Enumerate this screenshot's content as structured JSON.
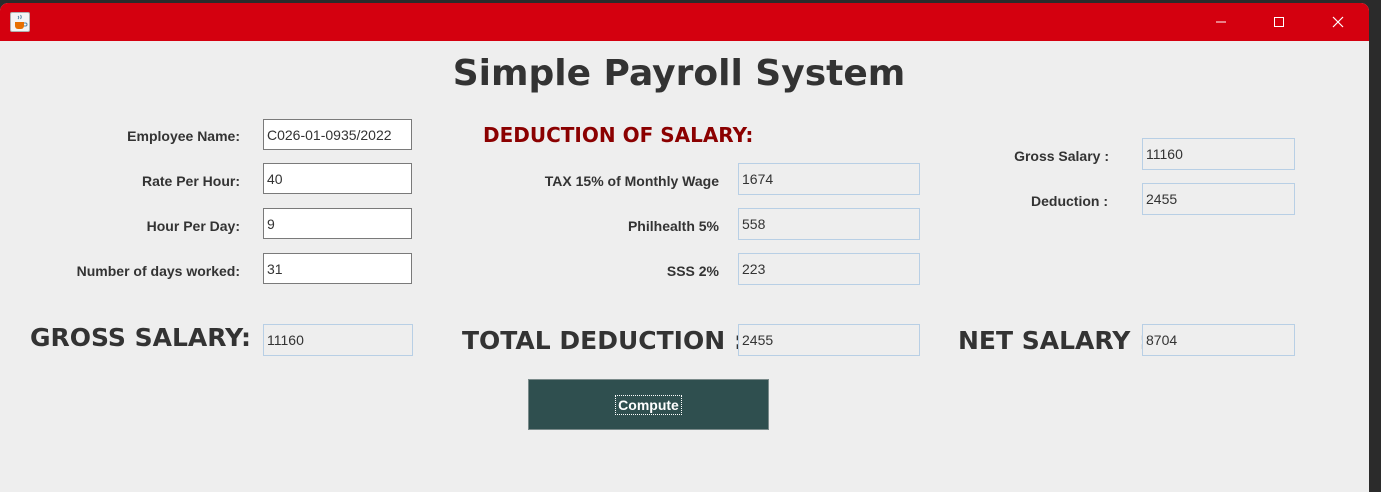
{
  "window": {
    "icon": "java-cup-icon",
    "controls": [
      "minimize-icon",
      "maximize-icon",
      "close-icon"
    ]
  },
  "title": "Simple Payroll System",
  "inputs": {
    "employee_name_label": "Employee Name:",
    "employee_name_value": "C026-01-0935/2022",
    "rate_label": "Rate Per Hour:",
    "rate_value": "40",
    "hours_label": "Hour Per Day:",
    "hours_value": "9",
    "days_label": "Number of days worked:",
    "days_value": "31"
  },
  "deductions": {
    "heading": "DEDUCTION OF SALARY:",
    "tax_label": "TAX  15% of Monthly Wage",
    "tax_value": "1674",
    "philhealth_label": "Philhealth 5%",
    "philhealth_value": "558",
    "sss_label": "SSS 2%",
    "sss_value": "223"
  },
  "summary": {
    "gross_label": "Gross Salary :",
    "gross_value": "11160",
    "deduction_label": "Deduction :",
    "deduction_value": "2455"
  },
  "totals": {
    "gross_label": "GROSS SALARY:",
    "gross_value": "11160",
    "total_deduction_label": "TOTAL DEDUCTION :",
    "total_deduction_value": "2455",
    "net_label": "NET SALARY :",
    "net_value": "8704"
  },
  "actions": {
    "compute_label": "Compute"
  },
  "colors": {
    "titlebar": "#d4000f",
    "section_heading": "#8b0000",
    "button": "#2f4f4f"
  }
}
